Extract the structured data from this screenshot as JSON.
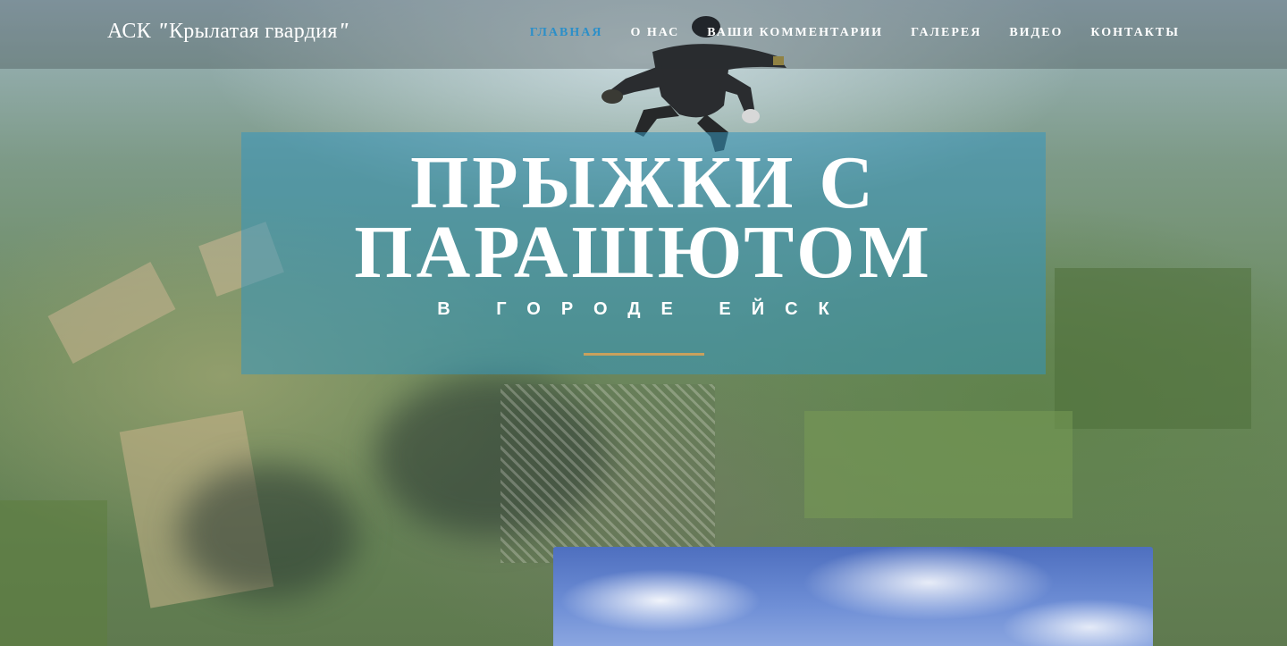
{
  "header": {
    "brand_prefix": "АСК ",
    "brand_open_quote": "\"",
    "brand_name": "Крылатая гвардия",
    "brand_close_quote": "\"",
    "nav": [
      {
        "label": "Главная",
        "active": true
      },
      {
        "label": "О нас",
        "active": false
      },
      {
        "label": "Ваши комментарии",
        "active": false
      },
      {
        "label": "Галерея",
        "active": false
      },
      {
        "label": "Видео",
        "active": false
      },
      {
        "label": "Контакты",
        "active": false
      }
    ]
  },
  "hero": {
    "title_line1": "ПРЫЖКИ С",
    "title_line2": "ПАРАШЮТОМ",
    "subtitle": "В ГОРОДЕ ЕЙСК"
  },
  "colors": {
    "nav_active": "#2b8fc9",
    "hero_box": "#3496be",
    "accent_line": "#c9a15d"
  }
}
